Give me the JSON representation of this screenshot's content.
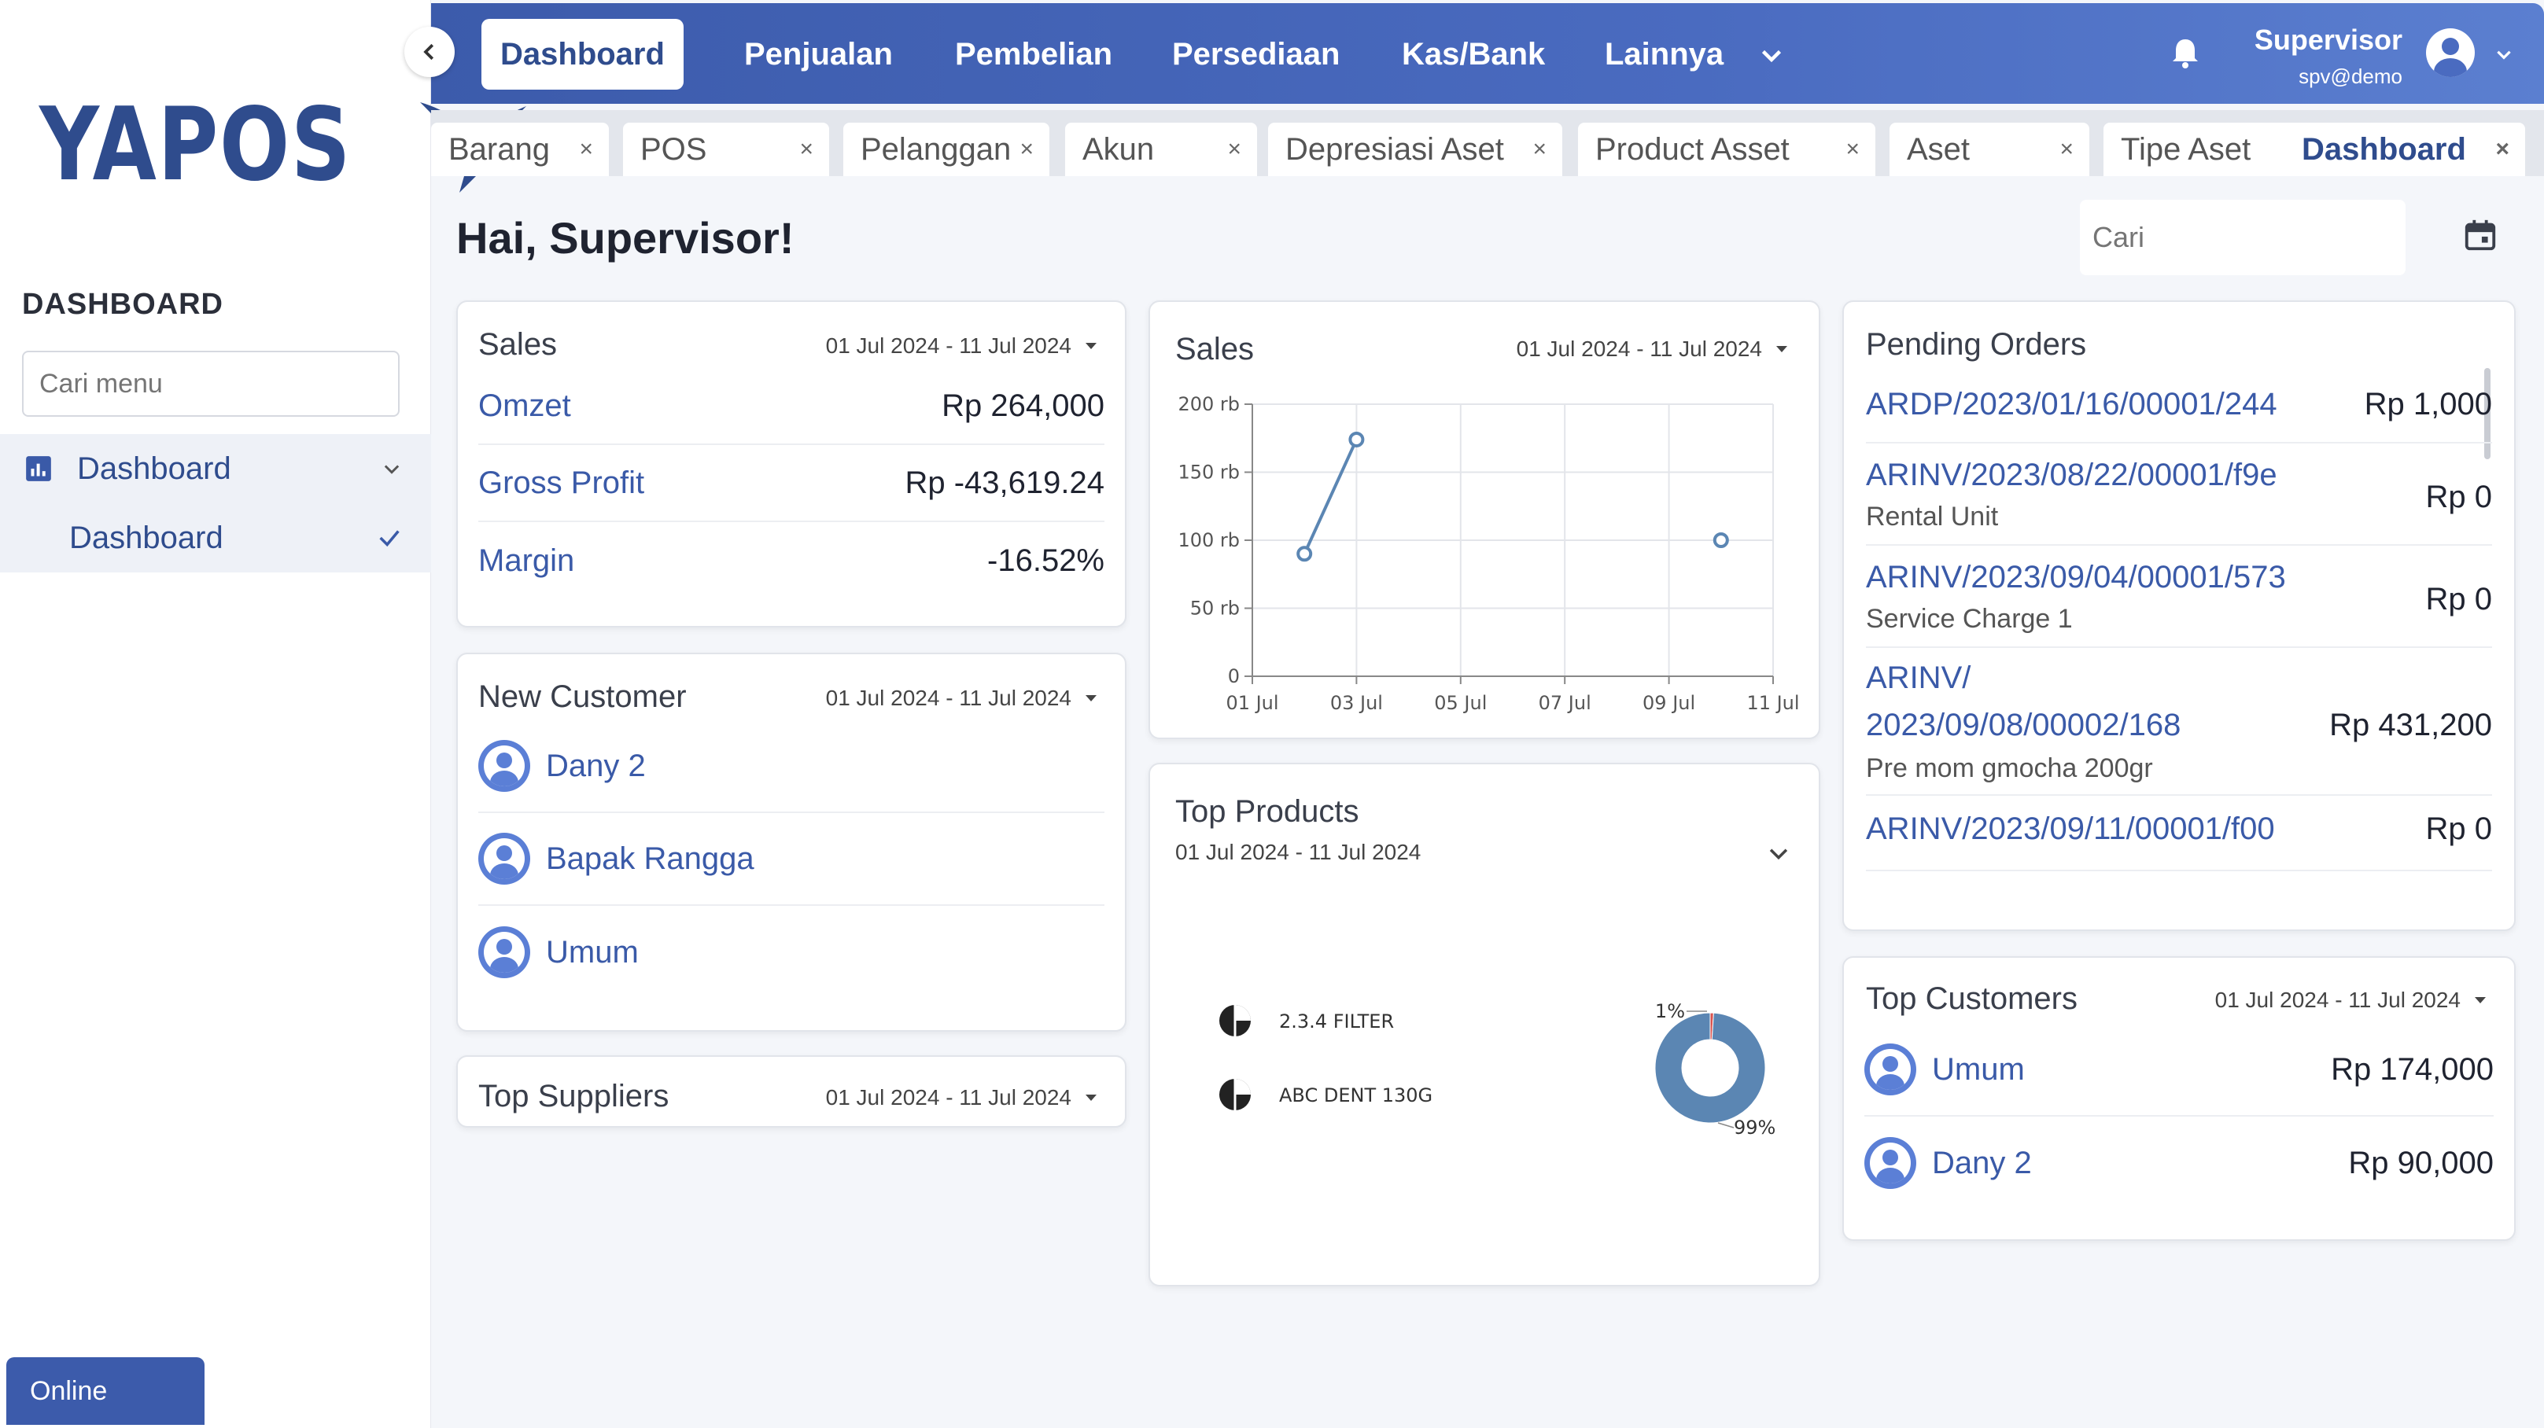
{
  "sidebar": {
    "logo_text": "YAPOS",
    "section_title": "DASHBOARD",
    "search_placeholder": "Cari menu",
    "group_label": "Dashboard",
    "sub_item_label": "Dashboard",
    "status": "Online"
  },
  "nav": {
    "items": [
      "Dashboard",
      "Penjualan",
      "Pembelian",
      "Persediaan",
      "Kas/Bank",
      "Lainnya"
    ],
    "user_name": "Supervisor",
    "user_email": "spv@demo"
  },
  "tabs": [
    "Barang",
    "POS",
    "Pelanggan",
    "Akun",
    "Depresiasi Aset",
    "Product Asset",
    "Aset",
    "Tipe Aset",
    "Dashboard"
  ],
  "header": {
    "greeting": "Hai, Supervisor!",
    "search_placeholder": "Cari"
  },
  "sales_card": {
    "title": "Sales",
    "date_range": "01 Jul 2024 - 11 Jul 2024",
    "rows": [
      {
        "label": "Omzet",
        "value": "Rp 264,000"
      },
      {
        "label": "Gross Profit",
        "value": "Rp -43,619.24"
      },
      {
        "label": "Margin",
        "value": "-16.52%"
      }
    ]
  },
  "new_customer_card": {
    "title": "New Customer",
    "date_range": "01 Jul 2024 - 11 Jul 2024",
    "customers": [
      "Dany 2",
      "Bapak Rangga",
      "Umum"
    ]
  },
  "top_suppliers_card": {
    "title": "Top Suppliers",
    "date_range": "01 Jul 2024 - 11 Jul 2024"
  },
  "sales_chart_card": {
    "title": "Sales",
    "date_range": "01 Jul 2024 - 11 Jul 2024"
  },
  "top_products_card": {
    "title": "Top Products",
    "date_range": "01 Jul 2024 - 11 Jul 2024"
  },
  "pending_orders_card": {
    "title": "Pending Orders",
    "orders": [
      {
        "id": "ARDP/2023/01/16/00001/244",
        "sub": "",
        "amount": "Rp 1,000"
      },
      {
        "id": "ARINV/2023/08/22/00001/f9e",
        "sub": "Rental Unit",
        "amount": "Rp 0"
      },
      {
        "id": "ARINV/2023/09/04/00001/573",
        "sub": "Service Charge 1",
        "amount": "Rp 0"
      },
      {
        "id_line1": "ARINV/",
        "id_line2": "2023/09/08/00002/168",
        "sub": "Pre mom gmocha 200gr",
        "amount": "Rp 431,200"
      },
      {
        "id": "ARINV/2023/09/11/00001/f00",
        "sub": "",
        "amount": "Rp 0"
      }
    ]
  },
  "top_customers_card": {
    "title": "Top Customers",
    "date_range": "01 Jul 2024 - 11 Jul 2024",
    "customers": [
      {
        "name": "Umum",
        "amount": "Rp 174,000"
      },
      {
        "name": "Dany 2",
        "amount": "Rp 90,000"
      }
    ]
  },
  "chart_data": [
    {
      "type": "line",
      "title": "Sales",
      "x_tick_labels": [
        "01 Jul",
        "03 Jul",
        "05 Jul",
        "07 Jul",
        "09 Jul",
        "11 Jul"
      ],
      "y_tick_labels": [
        "0",
        "50 rb",
        "100 rb",
        "150 rb",
        "200 rb"
      ],
      "ylim": [
        0,
        200000
      ],
      "xlim": [
        1,
        11
      ],
      "grid": true,
      "series": [
        {
          "segments": [
            [
              {
                "x": 2,
                "y": 90000
              },
              {
                "x": 3,
                "y": 174000
              }
            ],
            [
              {
                "x": 10,
                "y": 100000
              }
            ]
          ]
        }
      ],
      "color": "#5b86b3"
    },
    {
      "type": "pie",
      "title": "Top Products",
      "legend_placement": "left",
      "slices": [
        {
          "label": "2.3.4 FILTER",
          "percent": 1,
          "percent_label": "1%",
          "color": "#d9534f"
        },
        {
          "label": "ABC DENT 130G",
          "percent": 99,
          "percent_label": "99%",
          "color": "#5b86b3"
        }
      ]
    }
  ]
}
